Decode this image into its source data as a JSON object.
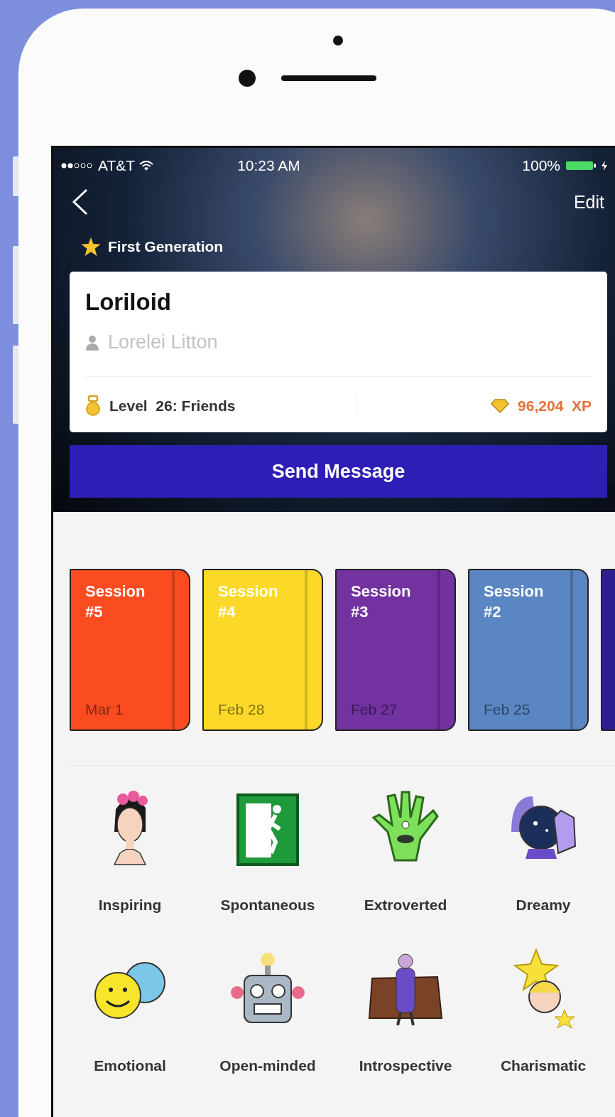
{
  "status_bar": {
    "carrier": "AT&T",
    "time": "10:23 AM",
    "battery": "100%"
  },
  "nav": {
    "action": "Edit"
  },
  "badge": {
    "label": "First Generation"
  },
  "profile": {
    "name": "Loriloid",
    "real_name": "Lorelei Litton",
    "level": "Level  26: Friends",
    "xp": "96,204  XP"
  },
  "send_button": "Send Message",
  "sessions": [
    {
      "title": "Session #5",
      "date": "Mar 1",
      "color": "#fb4c21"
    },
    {
      "title": "Session #4",
      "date": "Feb 28",
      "color": "#fcd928"
    },
    {
      "title": "Session #3",
      "date": "Feb 27",
      "color": "#7232a0"
    },
    {
      "title": "Session #2",
      "date": "Feb 25",
      "color": "#5a86c3"
    },
    {
      "color": "#2d1f8f"
    }
  ],
  "traits": [
    {
      "label": "Inspiring",
      "kind": "portrait"
    },
    {
      "label": "Spontaneous",
      "kind": "exit-sign"
    },
    {
      "label": "Extroverted",
      "kind": "hand"
    },
    {
      "label": "Dreamy",
      "kind": "crystal-ball"
    },
    {
      "label": "Emotional",
      "kind": "faces"
    },
    {
      "label": "Open-minded",
      "kind": "robot"
    },
    {
      "label": "Introspective",
      "kind": "figure"
    },
    {
      "label": "Charismatic",
      "kind": "star-person"
    }
  ]
}
